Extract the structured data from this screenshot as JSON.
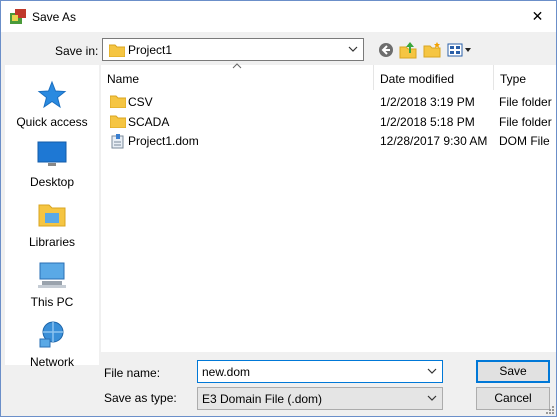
{
  "window": {
    "title": "Save As",
    "close_glyph": "✕"
  },
  "toolbar": {
    "save_in_label": "Save in:",
    "save_in_value": "Project1"
  },
  "toolbar_icons": [
    "back-icon",
    "up-folder-icon",
    "new-folder-icon",
    "view-menu-icon"
  ],
  "places": [
    {
      "label": "Quick access",
      "icon": "quick-access-star-icon"
    },
    {
      "label": "Desktop",
      "icon": "desktop-icon"
    },
    {
      "label": "Libraries",
      "icon": "libraries-icon"
    },
    {
      "label": "This PC",
      "icon": "this-pc-icon"
    },
    {
      "label": "Network",
      "icon": "network-icon"
    }
  ],
  "columns": {
    "name": "Name",
    "date": "Date modified",
    "type": "Type"
  },
  "files": [
    {
      "name": "CSV",
      "date": "1/2/2018 3:19 PM",
      "type": "File folder",
      "icon": "folder-icon"
    },
    {
      "name": "SCADA",
      "date": "1/2/2018 5:18 PM",
      "type": "File folder",
      "icon": "folder-icon"
    },
    {
      "name": "Project1.dom",
      "date": "12/28/2017 9:30 AM",
      "type": "DOM File",
      "icon": "dom-file-icon"
    }
  ],
  "form": {
    "file_name_label": "File name:",
    "file_name_value": "new.dom",
    "save_as_type_label": "Save as type:",
    "save_as_type_value": "E3 Domain File (.dom)"
  },
  "buttons": {
    "save": "Save",
    "cancel": "Cancel"
  },
  "colors": {
    "accent": "#0078d7",
    "folder": "#f5c542",
    "selection_border": "#0078d7"
  }
}
